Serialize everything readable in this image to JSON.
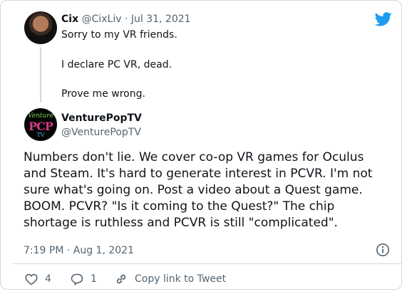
{
  "brand": {
    "icon": "twitter-bird-icon",
    "color": "#1d9bf0"
  },
  "parent_tweet": {
    "name": "Cix",
    "handle": "@CixLiv",
    "separator": "·",
    "date": "Jul 31, 2021",
    "lines": [
      "Sorry to my VR friends.",
      "I declare PC VR, dead.",
      "Prove me wrong."
    ]
  },
  "main_tweet": {
    "name": "VenturePopTV",
    "handle": "@VenturePopTV",
    "avatar": {
      "top": "Venture",
      "mid": "PCP",
      "bottom": "TV"
    },
    "body_lines": [
      "Numbers don't lie. We cover co-op VR games for  Oculus",
      "and Steam. It's hard to generate interest in PCVR. I'm not",
      "sure what's going on. Post a video about a Quest game.",
      "BOOM. PCVR? \"Is it coming to the Quest?\" The chip",
      "shortage is ruthless and PCVR is still \"complicated\"."
    ],
    "timestamp": "7:19 PM · Aug 1, 2021"
  },
  "actions": {
    "likes": "4",
    "replies": "1",
    "copy_link": "Copy link to Tweet"
  }
}
